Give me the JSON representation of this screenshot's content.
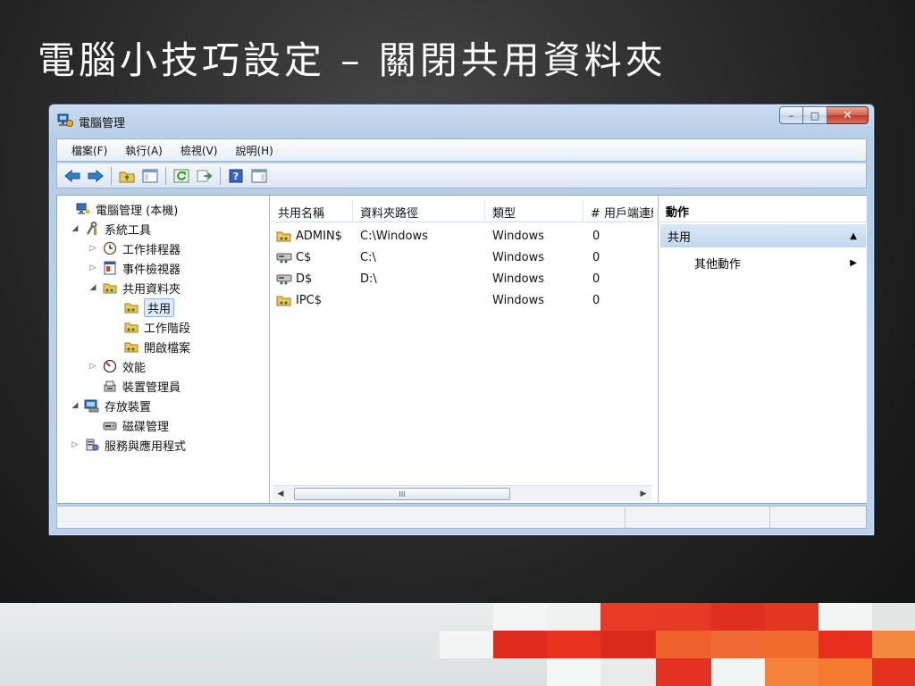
{
  "slide": {
    "title": "電腦小技巧設定 – 關閉共用資料夾"
  },
  "window": {
    "title": "電腦管理",
    "controls": {
      "minimize": "–",
      "maximize": "□",
      "close": "✕"
    }
  },
  "menu": [
    {
      "label": "檔案(F)"
    },
    {
      "label": "執行(A)"
    },
    {
      "label": "檢視(V)"
    },
    {
      "label": "說明(H)"
    }
  ],
  "tree": [
    {
      "label": "電腦管理 (本機)",
      "icon": "computer-management-icon",
      "arrow": ""
    },
    {
      "label": "系統工具",
      "icon": "system-tools-icon",
      "arrow": "◢"
    },
    {
      "label": "工作排程器",
      "icon": "clock-icon",
      "arrow": "▷"
    },
    {
      "label": "事件檢視器",
      "icon": "event-viewer-icon",
      "arrow": "▷"
    },
    {
      "label": "共用資料夾",
      "icon": "shared-folder-icon",
      "arrow": "◢"
    },
    {
      "label": "共用",
      "icon": "share-icon",
      "arrow": ""
    },
    {
      "label": "工作階段",
      "icon": "session-icon",
      "arrow": ""
    },
    {
      "label": "開啟檔案",
      "icon": "open-files-icon",
      "arrow": ""
    },
    {
      "label": "效能",
      "icon": "performance-icon",
      "arrow": "▷"
    },
    {
      "label": "裝置管理員",
      "icon": "device-manager-icon",
      "arrow": ""
    },
    {
      "label": "存放裝置",
      "icon": "storage-icon",
      "arrow": "◢"
    },
    {
      "label": "磁碟管理",
      "icon": "disk-management-icon",
      "arrow": ""
    },
    {
      "label": "服務與應用程式",
      "icon": "services-icon",
      "arrow": "▷"
    }
  ],
  "list": {
    "columns": [
      "共用名稱",
      "資料夾路徑",
      "類型",
      "# 用戶端連線"
    ],
    "rows": [
      {
        "name": "ADMIN$",
        "path": "C:\\Windows",
        "type": "Windows",
        "clients": "0",
        "icon": "shared-folder-icon"
      },
      {
        "name": "C$",
        "path": "C:\\",
        "type": "Windows",
        "clients": "0",
        "icon": "shared-drive-icon"
      },
      {
        "name": "D$",
        "path": "D:\\",
        "type": "Windows",
        "clients": "0",
        "icon": "shared-drive-icon"
      },
      {
        "name": "IPC$",
        "path": "",
        "type": "Windows",
        "clients": "0",
        "icon": "shared-folder-icon"
      }
    ],
    "scroll_thumb_label": "III"
  },
  "actions": {
    "title": "動作",
    "section": "共用",
    "item": "其他動作"
  },
  "colors": {
    "accent": "#c0392b",
    "selection": "#dceaf9",
    "window_frame": "#b6cde6"
  }
}
